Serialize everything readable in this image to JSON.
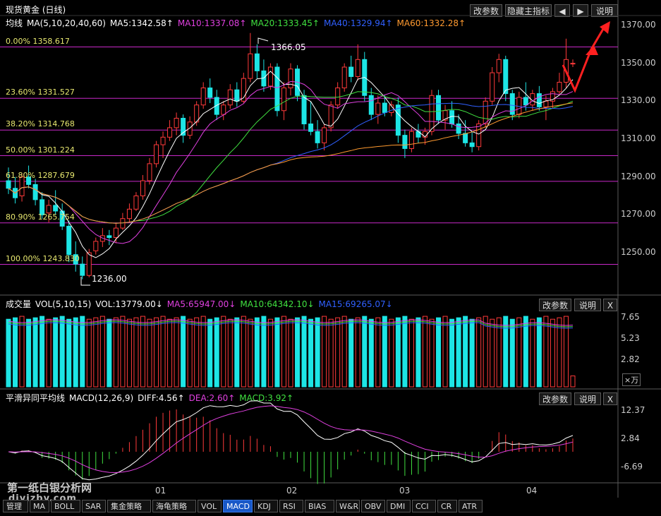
{
  "title": "现货黄金 (日线)",
  "toolbar": {
    "params": "改参数",
    "hide": "隐藏主指标",
    "prev": "◀",
    "next": "▶",
    "help": "说明"
  },
  "main_header": [
    {
      "text": "均线",
      "color": "#ffffff"
    },
    {
      "text": "MA(5,10,20,40,60)",
      "color": "#ffffff"
    },
    {
      "text": "MA5:1342.58↑",
      "color": "#ffffff"
    },
    {
      "text": "MA10:1337.08↑",
      "color": "#e040e0"
    },
    {
      "text": "MA20:1333.45↑",
      "color": "#40e040"
    },
    {
      "text": "MA40:1329.94↑",
      "color": "#3060ff"
    },
    {
      "text": "MA60:1332.28↑",
      "color": "#ff9a30"
    }
  ],
  "price_axis": [
    "1370.00",
    "1350.00",
    "1330.00",
    "1310.00",
    "1290.00",
    "1270.00",
    "1250.00"
  ],
  "fib_levels": [
    {
      "label": "0.00% 1358.617",
      "value": 1358.617
    },
    {
      "label": "23.60% 1331.527",
      "value": 1331.527
    },
    {
      "label": "38.20% 1314.768",
      "value": 1314.768
    },
    {
      "label": "50.00% 1301.224",
      "value": 1301.224
    },
    {
      "label": "61.80% 1287.679",
      "value": 1287.679
    },
    {
      "label": "80.90% 1265.754",
      "value": 1265.754
    },
    {
      "label": "100.00% 1243.830",
      "value": 1243.83
    }
  ],
  "annotations": {
    "high": "1366.05",
    "low": "1236.00"
  },
  "volume_header": [
    {
      "text": "成交量",
      "color": "#ffffff"
    },
    {
      "text": "VOL(5,10,15)",
      "color": "#ffffff"
    },
    {
      "text": "VOL:13779.00↓",
      "color": "#ffffff"
    },
    {
      "text": "MA5:65947.00↓",
      "color": "#e040e0"
    },
    {
      "text": "MA10:64342.10↓",
      "color": "#40e040"
    },
    {
      "text": "MA15:69265.07↓",
      "color": "#3060ff"
    }
  ],
  "volume_buttons": {
    "params": "改参数",
    "help": "说明",
    "close": "X"
  },
  "volume_axis": [
    "7.65",
    "5.23",
    "2.82"
  ],
  "volume_unit": "×万",
  "macd_header": [
    {
      "text": "平滑异同平均线",
      "color": "#ffffff"
    },
    {
      "text": "MACD(12,26,9)",
      "color": "#ffffff"
    },
    {
      "text": "DIFF:4.56↑",
      "color": "#ffffff"
    },
    {
      "text": "DEA:2.60↑",
      "color": "#e040e0"
    },
    {
      "text": "MACD:3.92↑",
      "color": "#40e040"
    }
  ],
  "macd_buttons": {
    "params": "改参数",
    "help": "说明",
    "close": "X"
  },
  "macd_axis": [
    "12.37",
    "2.84",
    "-6.69"
  ],
  "x_axis": [
    "01",
    "02",
    "03",
    "04"
  ],
  "watermark": {
    "line1": "第一纸白银分析网",
    "line2": "diyizby.com"
  },
  "tabs": [
    "管理",
    "MA",
    "BOLL",
    "SAR",
    "集金策略",
    "海龟策略",
    "VOL",
    "MACD",
    "KDJ",
    "RSI",
    "BIAS",
    "W&R",
    "OBV",
    "DMI",
    "CCI",
    "CR",
    "ATR"
  ],
  "active_tab": "MACD",
  "chart_data": {
    "type": "candlestick",
    "title": "现货黄金 (日线)",
    "ylim": [
      1236,
      1375
    ],
    "candles": [
      [
        1288,
        1295,
        1281,
        1284
      ],
      [
        1284,
        1290,
        1276,
        1279
      ],
      [
        1280,
        1292,
        1277,
        1290
      ],
      [
        1290,
        1296,
        1284,
        1286
      ],
      [
        1286,
        1289,
        1275,
        1278
      ],
      [
        1278,
        1282,
        1268,
        1270
      ],
      [
        1271,
        1278,
        1266,
        1275
      ],
      [
        1275,
        1283,
        1270,
        1272
      ],
      [
        1272,
        1276,
        1262,
        1264
      ],
      [
        1264,
        1267,
        1245,
        1249
      ],
      [
        1249,
        1256,
        1240,
        1244
      ],
      [
        1244,
        1248,
        1236,
        1238
      ],
      [
        1238,
        1252,
        1237,
        1250
      ],
      [
        1251,
        1258,
        1249,
        1256
      ],
      [
        1256,
        1263,
        1253,
        1259
      ],
      [
        1259,
        1262,
        1254,
        1258
      ],
      [
        1258,
        1266,
        1255,
        1263
      ],
      [
        1263,
        1271,
        1262,
        1268
      ],
      [
        1268,
        1276,
        1266,
        1273
      ],
      [
        1273,
        1282,
        1272,
        1280
      ],
      [
        1280,
        1291,
        1278,
        1288
      ],
      [
        1288,
        1300,
        1286,
        1297
      ],
      [
        1297,
        1309,
        1295,
        1307
      ],
      [
        1307,
        1314,
        1300,
        1311
      ],
      [
        1311,
        1320,
        1309,
        1316
      ],
      [
        1316,
        1324,
        1312,
        1321
      ],
      [
        1321,
        1323,
        1308,
        1312
      ],
      [
        1312,
        1322,
        1310,
        1319
      ],
      [
        1319,
        1330,
        1317,
        1328
      ],
      [
        1328,
        1340,
        1326,
        1337
      ],
      [
        1337,
        1342,
        1329,
        1332
      ],
      [
        1332,
        1336,
        1320,
        1323
      ],
      [
        1323,
        1330,
        1320,
        1328
      ],
      [
        1328,
        1339,
        1326,
        1336
      ],
      [
        1336,
        1340,
        1327,
        1330
      ],
      [
        1330,
        1345,
        1329,
        1342
      ],
      [
        1342,
        1366,
        1340,
        1355
      ],
      [
        1355,
        1360,
        1342,
        1346
      ],
      [
        1346,
        1352,
        1335,
        1338
      ],
      [
        1338,
        1350,
        1336,
        1348
      ],
      [
        1348,
        1350,
        1322,
        1325
      ],
      [
        1325,
        1340,
        1320,
        1337
      ],
      [
        1337,
        1350,
        1333,
        1347
      ],
      [
        1347,
        1349,
        1330,
        1333
      ],
      [
        1333,
        1336,
        1315,
        1318
      ],
      [
        1318,
        1330,
        1312,
        1314
      ],
      [
        1314,
        1320,
        1305,
        1308
      ],
      [
        1308,
        1318,
        1304,
        1316
      ],
      [
        1316,
        1330,
        1314,
        1328
      ],
      [
        1328,
        1340,
        1326,
        1337
      ],
      [
        1337,
        1350,
        1335,
        1348
      ],
      [
        1348,
        1354,
        1340,
        1343
      ],
      [
        1343,
        1360,
        1341,
        1352
      ],
      [
        1352,
        1356,
        1330,
        1333
      ],
      [
        1333,
        1337,
        1320,
        1323
      ],
      [
        1323,
        1333,
        1318,
        1329
      ],
      [
        1329,
        1333,
        1322,
        1324
      ],
      [
        1324,
        1330,
        1322,
        1328
      ],
      [
        1328,
        1332,
        1308,
        1312
      ],
      [
        1312,
        1315,
        1300,
        1305
      ],
      [
        1305,
        1316,
        1303,
        1314
      ],
      [
        1314,
        1318,
        1308,
        1311
      ],
      [
        1311,
        1316,
        1307,
        1314
      ],
      [
        1314,
        1336,
        1312,
        1333
      ],
      [
        1333,
        1336,
        1318,
        1320
      ],
      [
        1320,
        1328,
        1315,
        1325
      ],
      [
        1325,
        1330,
        1316,
        1318
      ],
      [
        1318,
        1323,
        1310,
        1313
      ],
      [
        1313,
        1320,
        1306,
        1308
      ],
      [
        1308,
        1314,
        1303,
        1306
      ],
      [
        1306,
        1320,
        1304,
        1318
      ],
      [
        1318,
        1332,
        1316,
        1330
      ],
      [
        1330,
        1348,
        1328,
        1345
      ],
      [
        1345,
        1355,
        1340,
        1352
      ],
      [
        1352,
        1354,
        1330,
        1334
      ],
      [
        1334,
        1336,
        1320,
        1323
      ],
      [
        1323,
        1335,
        1321,
        1332
      ],
      [
        1332,
        1340,
        1325,
        1328
      ],
      [
        1328,
        1336,
        1325,
        1334
      ],
      [
        1334,
        1338,
        1325,
        1327
      ],
      [
        1327,
        1333,
        1320,
        1330
      ],
      [
        1330,
        1337,
        1326,
        1335
      ],
      [
        1335,
        1345,
        1333,
        1340
      ],
      [
        1340,
        1363,
        1337,
        1352
      ],
      [
        1350,
        1352,
        1348,
        1350
      ]
    ],
    "volume_max": 7.65,
    "macd_range": [
      -9,
      14
    ]
  }
}
